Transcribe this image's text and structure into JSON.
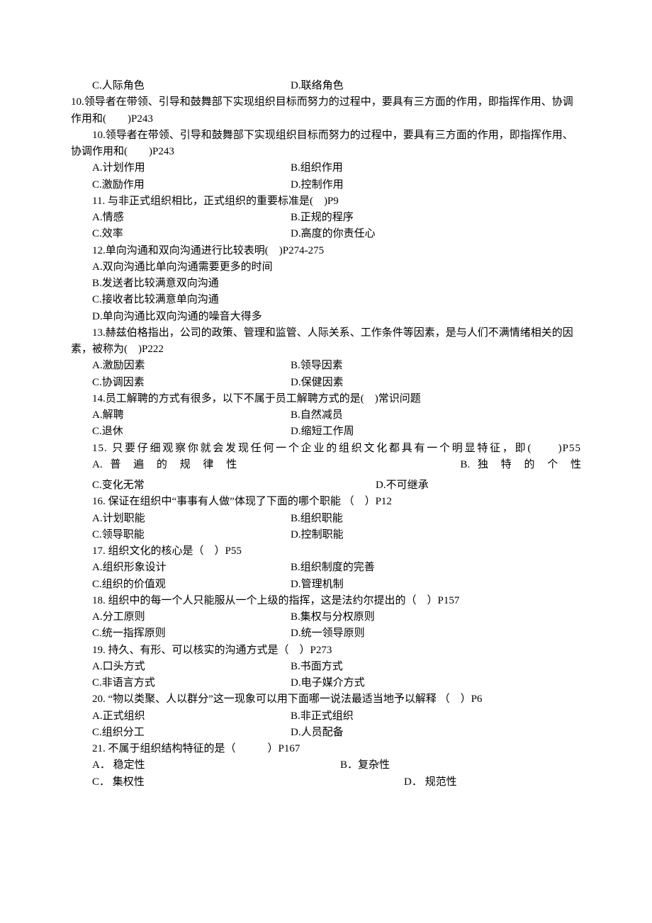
{
  "q9": {
    "C": "C.人际角色",
    "D": "D.联络角色"
  },
  "q10": {
    "stem": "10.领导者在带领、引导和鼓舞部下实现组织目标而努力的过程中，要具有三方面的作用，即指挥作用、协调作用和(　　)P243",
    "A": "A.计划作用",
    "B": "B.组织作用",
    "C": "C.激励作用",
    "D": "D.控制作用"
  },
  "q11": {
    "stem": "11. 与非正式组织相比，正式组织的重要标准是(　)P9",
    "A": "A.情感",
    "B": "B.正规的程序",
    "C": "C.效率",
    "D": "D.高度的你责任心"
  },
  "q12": {
    "stem": "12.单向沟通和双向沟通进行比较表明(　)P274-275",
    "A": "A.双向沟通比单向沟通需要更多的时间",
    "B": "B.发送者比较满意双向沟通",
    "C": "C.接收者比较满意单向沟通",
    "D": "D.单向沟通比双向沟通的噪音大得多"
  },
  "q13": {
    "stem": "13.赫兹伯格指出，公司的政策、管理和监管、人际关系、工作条件等因素，是与人们不满情绪相关的因素，被称为(　)P222",
    "A": "A.激励因素",
    "B": "B.领导因素",
    "C": "C.协调因素",
    "D": "D.保健因素"
  },
  "q14": {
    "stem": "14.员工解聘的方式有很多，以下不属于员工解聘方式的是(　)常识问题",
    "A": "A.解聘",
    "B": "B.自然减员",
    "C": "C.退休",
    "D": "D.缩短工作周"
  },
  "q15": {
    "stem1": "15. 只要仔细观察你就会发现任何一个企业的组织文化都具有一个明显特征，即(　　)P55",
    "A": "A. 普 遍 的 规 律 性　　　　　　　　　　　　　　B. 独 特 的 个 性",
    "C": "C.变化无常",
    "D": "D.不可继承"
  },
  "q16": {
    "stem": "16. 保证在组织中“事事有人做”体现了下面的哪个职能 （　）P12",
    "A": "A.计划职能",
    "B": "B.组织职能",
    "C": "C.领导职能",
    "D": "D.控制职能"
  },
  "q17": {
    "stem": "17. 组织文化的核心是（　）P55",
    "A": "A.组织形象设计",
    "B": "B.组织制度的完善",
    "C": "C.组织的价值观",
    "D": "D.管理机制"
  },
  "q18": {
    "stem": "18. 组织中的每一个人只能服从一个上级的指挥，这是法约尔提出的（　）P157",
    "A": "A.分工原则",
    "B": "B.集权与分权原则",
    "C": "C.统一指挥原则",
    "D": "D.统一领导原则"
  },
  "q19": {
    "stem": "19. 持久、有形、可以核实的沟通方式是（　）P273",
    "A": "A.口头方式",
    "B": "B.书面方式",
    "C": "C.非语言方式",
    "D": "D.电子媒介方式"
  },
  "q20": {
    "stem": "20. “物以类聚、人以群分”这一现象可以用下面哪一说法最适当地予以解释 （　）P6",
    "A": "A.正式组织",
    "B": "B.非正式组织",
    "C": "C.组织分工",
    "D": "D.人员配备"
  },
  "q21": {
    "stem": "21. 不属于组织结构特征的是（　　　）P167",
    "A": "A． 稳定性",
    "B": "B．复杂性",
    "C": "C． 集权性",
    "D": "D． 规范性"
  }
}
